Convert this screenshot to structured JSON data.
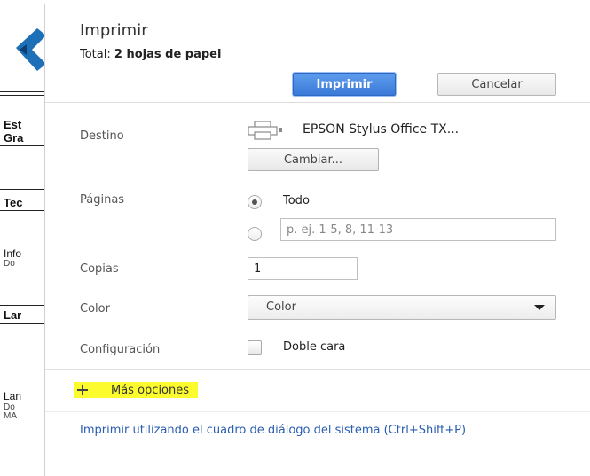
{
  "background_doc": {
    "lines": [
      {
        "text": "Est",
        "bold": true
      },
      {
        "text": "Gra",
        "bold": true
      },
      {
        "text": "Tec",
        "bold": true
      },
      {
        "text": "Info",
        "bold": false
      },
      {
        "text": "Do",
        "bold": false
      },
      {
        "text": "Lar",
        "bold": true
      },
      {
        "text": "Lan",
        "bold": false
      },
      {
        "text": "Do",
        "bold": false
      },
      {
        "text": "MA",
        "bold": false
      }
    ]
  },
  "dialog": {
    "title": "Imprimir",
    "total_label": "Total:",
    "total_value": "2 hojas de papel",
    "print_button": "Imprimir",
    "cancel_button": "Cancelar",
    "destination": {
      "label": "Destino",
      "printer_name": "EPSON Stylus Office TX...",
      "change_button": "Cambiar..."
    },
    "pages": {
      "label": "Páginas",
      "option_all": "Todo",
      "range_placeholder": "p. ej. 1-5, 8, 11-13"
    },
    "copies": {
      "label": "Copias",
      "value": "1"
    },
    "color": {
      "label": "Color",
      "selected": "Color"
    },
    "settings": {
      "label": "Configuración",
      "duplex_label": "Doble cara"
    },
    "more_options": "Más opciones",
    "system_dialog_link": "Imprimir utilizando el cuadro de diálogo del sistema (Ctrl+Shift+P)"
  },
  "colors": {
    "primary_button": "#3a7ad8",
    "highlight": "#fbfb2e",
    "link": "#2a5db0"
  }
}
